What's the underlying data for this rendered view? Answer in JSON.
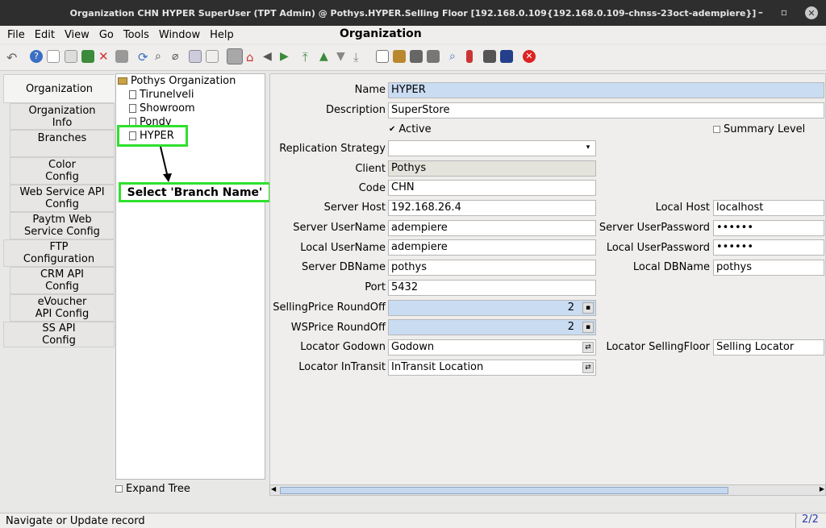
{
  "titlebar": {
    "title": "Organization  CHN  HYPER  SuperUser (TPT Admin) @ Pothys.HYPER.Selling Floor [192.168.0.109{192.168.0.109-chnss-23oct-adempiere}]"
  },
  "menu": [
    "File",
    "Edit",
    "View",
    "Go",
    "Tools",
    "Window",
    "Help"
  ],
  "window_title": "Organization",
  "tabs": [
    "Organization",
    "Organization Info",
    "Branches",
    "Color Config",
    "Web Service API Config",
    "Paytm Web Service Config",
    "FTP Configuration",
    "CRM API Config",
    "eVoucher API Config",
    "SS API Config"
  ],
  "tree": {
    "root": "Pothys Organization",
    "children": [
      "Tirunelveli",
      "Showroom",
      "Pondy",
      "HYPER"
    ]
  },
  "expand_tree": "Expand Tree",
  "callout": "Select 'Branch Name'",
  "form": {
    "name_label": "Name",
    "name": "HYPER",
    "description_label": "Description",
    "description": "SuperStore",
    "active_label": "Active",
    "summary_label": "Summary Level",
    "replication_label": "Replication Strategy",
    "client_label": "Client",
    "client": "Pothys",
    "code_label": "Code",
    "code": "CHN",
    "server_host_label": "Server Host",
    "server_host": "192.168.26.4",
    "local_host_label": "Local Host",
    "local_host": "localhost",
    "server_user_label": "Server UserName",
    "server_user": "adempiere",
    "server_pwd_label": "Server UserPassword",
    "server_pwd": "••••••",
    "local_user_label": "Local UserName",
    "local_user": "adempiere",
    "local_pwd_label": "Local UserPassword",
    "local_pwd": "••••••",
    "server_db_label": "Server DBName",
    "server_db": "pothys",
    "local_db_label": "Local DBName",
    "local_db": "pothys",
    "port_label": "Port",
    "port": "5432",
    "sp_round_label": "SellingPrice RoundOff",
    "sp_round": "2",
    "ws_round_label": "WSPrice RoundOff",
    "ws_round": "2",
    "loc_godown_label": "Locator Godown",
    "loc_godown": "Godown",
    "loc_sf_label": "Locator SellingFloor",
    "loc_sf": "Selling Locator",
    "loc_transit_label": "Locator InTransit",
    "loc_transit": "InTransit Location"
  },
  "status": {
    "text": "Navigate or Update record",
    "pages": "2/2"
  },
  "colors": {
    "highlight": "#2fe02f",
    "required_field": "#c9dcf2",
    "titlebar": "#2e2e2e"
  }
}
